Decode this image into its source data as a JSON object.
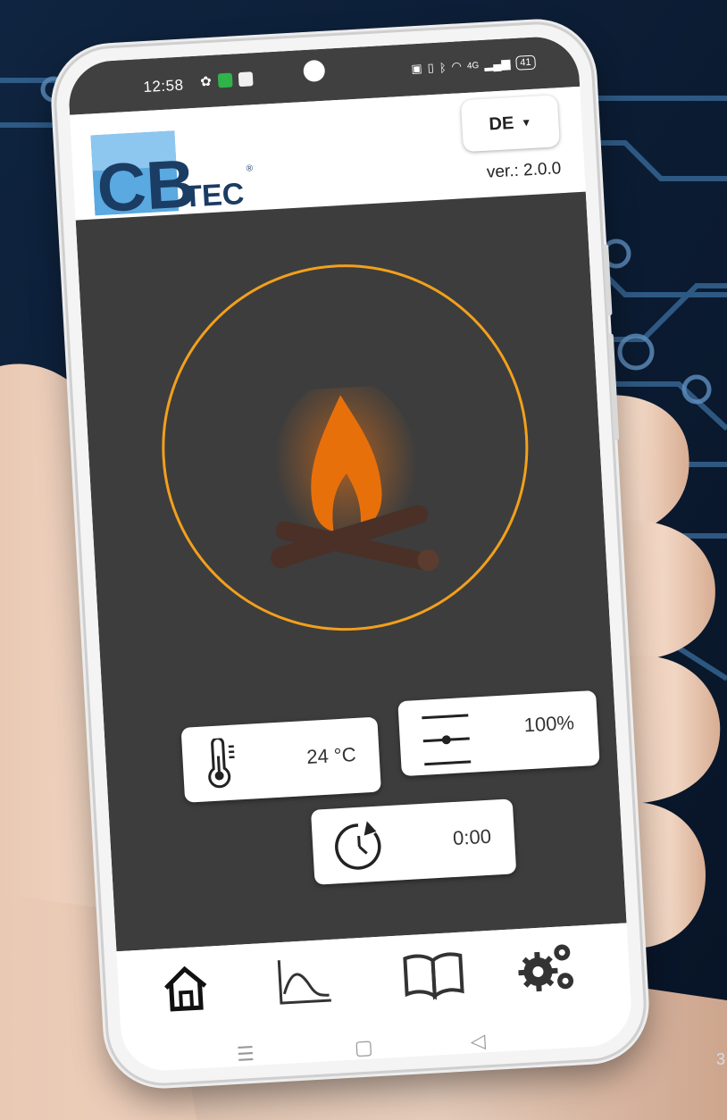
{
  "status_bar": {
    "time": "12:58",
    "battery": "41",
    "network": "4G"
  },
  "header": {
    "logo_primary": "CB",
    "logo_secondary": "TEC",
    "language_button": "DE",
    "version": "ver.: 2.0.0"
  },
  "main": {
    "flame_ring_color": "#f2a01c",
    "flame_color": "#e8700a",
    "temperature": "24 °C",
    "power": "100%",
    "timer": "0:00"
  },
  "bottom_nav": {
    "items": [
      {
        "icon": "home-icon"
      },
      {
        "icon": "chart-icon"
      },
      {
        "icon": "book-icon"
      },
      {
        "icon": "settings-icon"
      }
    ]
  },
  "page_number": "3"
}
